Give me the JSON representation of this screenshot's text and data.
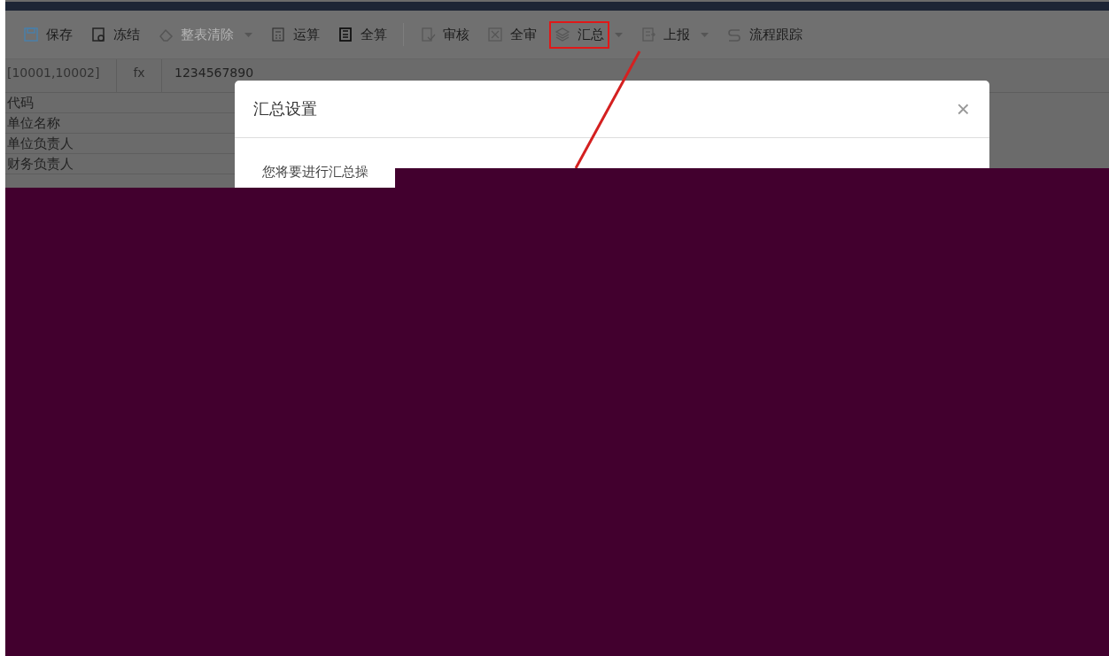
{
  "toolbar": [
    {
      "label": "保存",
      "kind": "button",
      "disabled": false,
      "highlighted": false
    },
    {
      "label": "冻结",
      "kind": "button",
      "disabled": false,
      "highlighted": false
    },
    {
      "label": "整表清除",
      "kind": "dropdown",
      "disabled": true,
      "highlighted": false
    },
    {
      "label": "运算",
      "kind": "button",
      "disabled": false,
      "highlighted": false
    },
    {
      "label": "全算",
      "kind": "button",
      "disabled": false,
      "highlighted": false
    },
    {
      "kind": "separator"
    },
    {
      "label": "审核",
      "kind": "button",
      "disabled": false,
      "highlighted": false
    },
    {
      "label": "全审",
      "kind": "button",
      "disabled": false,
      "highlighted": false
    },
    {
      "label": "汇总",
      "kind": "dropdown",
      "disabled": false,
      "highlighted": true
    },
    {
      "label": "上报",
      "kind": "dropdown",
      "disabled": false,
      "highlighted": false
    },
    {
      "label": "流程跟踪",
      "kind": "button",
      "disabled": false,
      "highlighted": false
    }
  ],
  "formula_bar": {
    "cell_ref": "[10001,10002]",
    "fx": "fx",
    "value": "1234567890"
  },
  "rows": [
    "代码",
    "单位名称",
    "单位负责人",
    "财务负责人"
  ],
  "dialog": {
    "title": "汇总设置",
    "close": "×",
    "message": "您将要进行汇总操"
  }
}
